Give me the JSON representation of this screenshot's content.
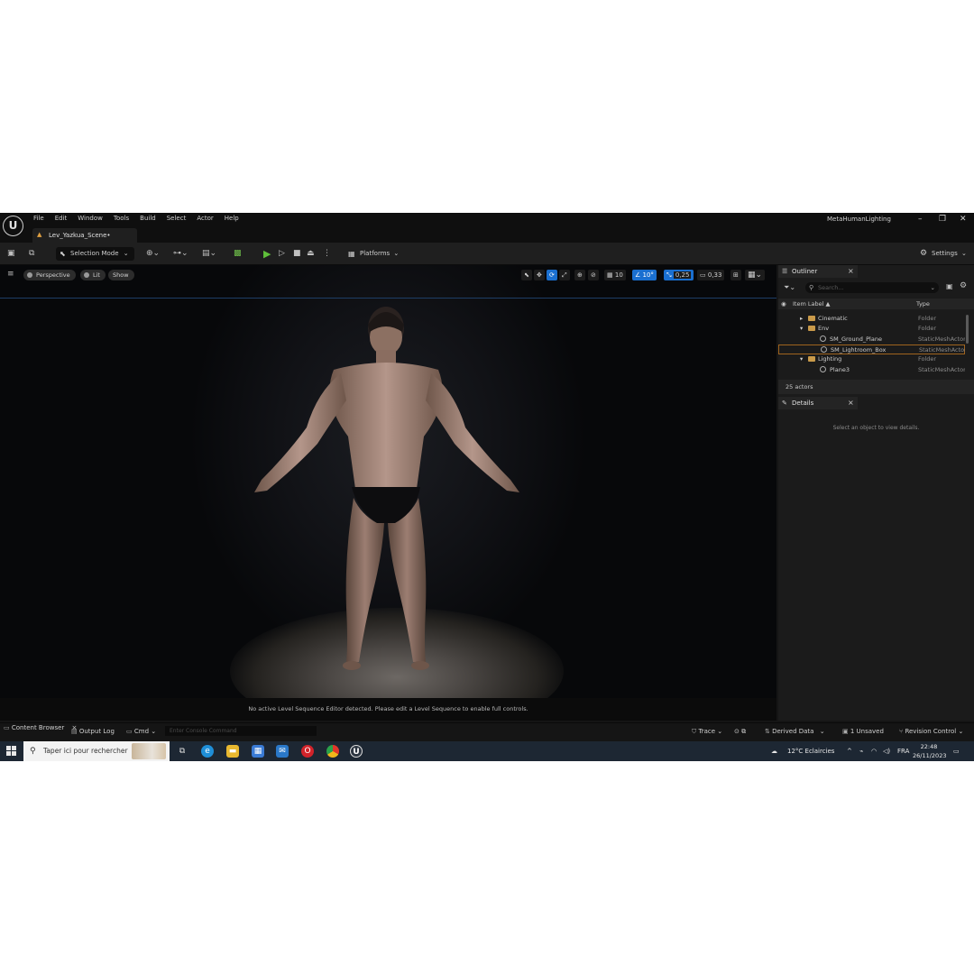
{
  "menu": [
    "File",
    "Edit",
    "Window",
    "Tools",
    "Build",
    "Select",
    "Actor",
    "Help"
  ],
  "project_name": "MetaHumanLighting",
  "window_controls": {
    "minimize": "–",
    "restore": "❐",
    "close": "✕"
  },
  "level_tab": {
    "label": "Lev_Yazkua_Scene•"
  },
  "toolbar": {
    "selection_mode": "Selection Mode",
    "platforms": "Platforms",
    "settings": "Settings"
  },
  "viewport": {
    "perspective": "Perspective",
    "lit": "Lit",
    "show": "Show",
    "grid_snap": "10",
    "rotation_snap": "10°",
    "scale_snap": "0,25",
    "camera_speed": "0,33",
    "status_message": "No active Level Sequence Editor detected. Please edit a Level Sequence to enable full controls."
  },
  "outliner": {
    "tab_label": "Outliner",
    "search_placeholder": "Search...",
    "col_item_label": "Item Label ▲",
    "col_type": "Type",
    "rows": [
      {
        "label": "Cinematic",
        "type": "Folder",
        "kind": "folder",
        "indent": 0,
        "arrow": "▸",
        "selected": false
      },
      {
        "label": "Env",
        "type": "Folder",
        "kind": "folder",
        "indent": 0,
        "arrow": "▾",
        "selected": false
      },
      {
        "label": "SM_Ground_Plane",
        "type": "StaticMeshActor",
        "kind": "mesh",
        "indent": 1,
        "arrow": "",
        "selected": false
      },
      {
        "label": "SM_Lightroom_Box",
        "type": "StaticMeshActor",
        "kind": "mesh",
        "indent": 1,
        "arrow": "",
        "selected": true
      },
      {
        "label": "Lighting",
        "type": "Folder",
        "kind": "folder",
        "indent": 0,
        "arrow": "▾",
        "selected": false
      },
      {
        "label": "Plane3",
        "type": "StaticMeshActor",
        "kind": "mesh",
        "indent": 1,
        "arrow": "",
        "selected": false
      }
    ],
    "actor_count": "25 actors"
  },
  "details": {
    "tab_label": "Details",
    "hint": "Select an object to view details."
  },
  "bottom_bar": {
    "content_browser": "Content Browser",
    "output_log": "Output Log",
    "cmd": "Cmd",
    "console_placeholder": "Enter Console Command",
    "trace": "Trace",
    "derived_data": "Derived Data",
    "unsaved": "1 Unsaved",
    "revision_control": "Revision Control"
  },
  "taskbar": {
    "search_text": "Taper ici pour rechercher",
    "weather": "12°C  Eclaircies",
    "language": "FRA",
    "time": "22:48",
    "date": "26/11/2023"
  },
  "colors": {
    "accent_blue": "#1a6fd0",
    "play_green": "#5fbf3a",
    "folder": "#c99a4a",
    "selection_outline": "#a0641e"
  }
}
